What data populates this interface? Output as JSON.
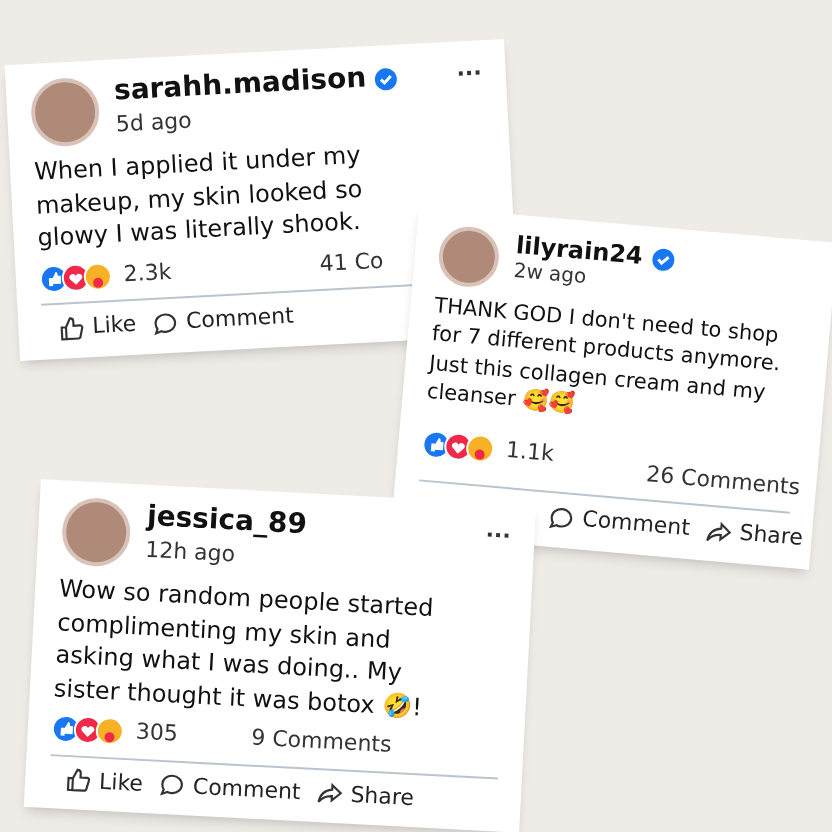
{
  "posts": [
    {
      "username": "sarahh.madison",
      "verified": true,
      "time": "5d ago",
      "menu": "...",
      "text": "When I applied it under my makeup, my skin looked so glowy I was literally shook.",
      "reactions": "2.3k",
      "comments": "41 Co",
      "actions": [
        {
          "kind": "like",
          "label": "Like"
        },
        {
          "kind": "comment",
          "label": "Comment"
        }
      ]
    },
    {
      "username": "lilyrain24",
      "verified": true,
      "time": "2w ago",
      "text": "THANK GOD I don't need to shop for 7 different products anymore. Just this collagen cream and my cleanser 🥰🥰",
      "reactions": "1.1k",
      "comments": "26 Comments",
      "actions": [
        {
          "kind": "comment",
          "label": "Comment"
        },
        {
          "kind": "share",
          "label": "Share"
        }
      ]
    },
    {
      "username": "jessica_89",
      "verified": false,
      "time": "12h ago",
      "menu": "...",
      "text": "Wow so random people started complimenting my skin and asking what I was doing.. My sister thought it was botox 🤣!",
      "reactions": "305",
      "comments": "9 Comments",
      "actions": [
        {
          "kind": "like",
          "label": "Like"
        },
        {
          "kind": "comment",
          "label": "Comment"
        },
        {
          "kind": "share",
          "label": "Share"
        }
      ]
    }
  ]
}
